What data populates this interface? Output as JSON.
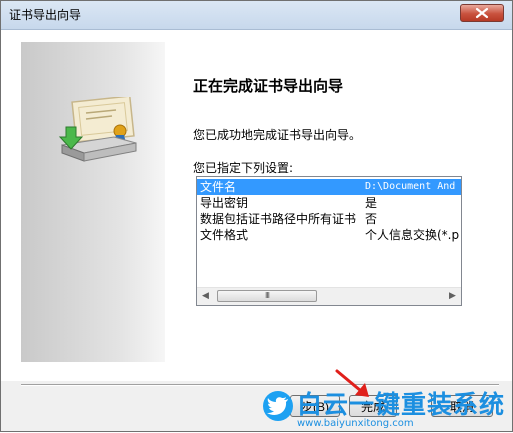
{
  "window": {
    "title": "证书导出向导"
  },
  "page": {
    "title": "正在完成证书导出向导",
    "success_text": "您已成功地完成证书导出向导。",
    "settings_label": "您已指定下列设置:"
  },
  "settings": [
    {
      "key": "文件名",
      "value": "D:\\Document And"
    },
    {
      "key": "导出密钥",
      "value": "是"
    },
    {
      "key": "数据包括证书路径中所有证书",
      "value": "否"
    },
    {
      "key": "文件格式",
      "value": "个人信息交换(*.p"
    }
  ],
  "scrollbar": {
    "left_arrow": "◀",
    "right_arrow": "▶",
    "grip": "III"
  },
  "buttons": {
    "back": "步(B)",
    "finish": "完成",
    "cancel": "取消"
  },
  "watermark": {
    "text": "白云一键重装系统",
    "url": "www.baiyunxitong.com"
  },
  "colors": {
    "selection": "#3399ff",
    "watermark": "#1c8fe0",
    "close_button": "#c9523e"
  }
}
